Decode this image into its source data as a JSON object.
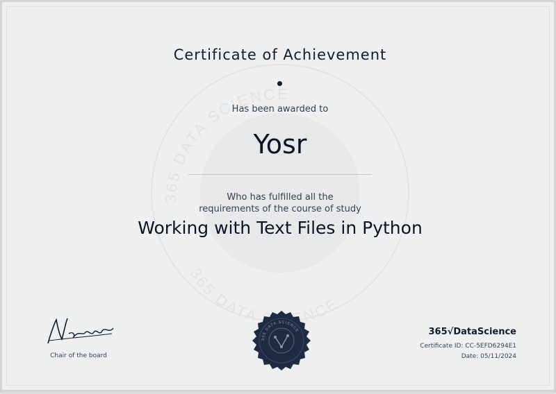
{
  "certificate": {
    "title": "Certificate of Achievement",
    "awarded_text": "Has been awarded to",
    "recipient": "Yosr",
    "fulfilled_line1": "Who has fulfilled all the",
    "fulfilled_line2": "requirements of the course of study",
    "course": "Working with Text Files in Python"
  },
  "signature": {
    "signer_label": "Chair of the board",
    "signature_text": "N.Krastev"
  },
  "issuer": {
    "logo_text": "365√DataScience",
    "watermark_text": "365 DATA SCIENCE",
    "certificate_id_label": "Certificate ID:",
    "certificate_id": "CC-5EFD6294E1",
    "date_label": "Date:",
    "date": "05/11/2024"
  },
  "colors": {
    "ink": "#161b2b",
    "seal": "#1f2a44",
    "background": "#edeff0"
  }
}
